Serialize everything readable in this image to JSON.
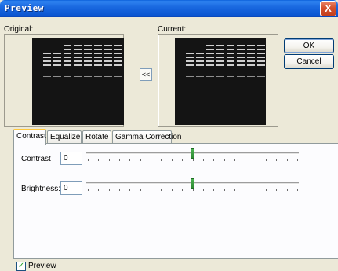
{
  "window": {
    "title": "Preview",
    "close_glyph": "X"
  },
  "panes": {
    "original_label": "Original:",
    "current_label": "Current:",
    "copy_button_label": "<<"
  },
  "buttons": {
    "ok": "OK",
    "cancel": "Cancel"
  },
  "tabs": [
    {
      "label": "Contrast",
      "active": true
    },
    {
      "label": "Equalize",
      "active": false
    },
    {
      "label": "Rotate",
      "active": false
    },
    {
      "label": "Gamma Correction",
      "active": false
    }
  ],
  "contrast_tab": {
    "contrast": {
      "label": "Contrast",
      "value": "0",
      "slider_fraction": 0.5
    },
    "brightness": {
      "label": "Brightness:",
      "value": "0",
      "slider_fraction": 0.5
    }
  },
  "preview_checkbox": {
    "label": "Preview",
    "checked": true,
    "check_glyph": "✓"
  },
  "colors": {
    "titlebar": "#0b56d2",
    "close_button": "#d4502d",
    "slider_thumb": "#2d8a33",
    "active_tab_accent": "#ffc83c",
    "gel_background": "#141414"
  },
  "icons": {
    "close": "close-icon",
    "check": "check-icon"
  }
}
